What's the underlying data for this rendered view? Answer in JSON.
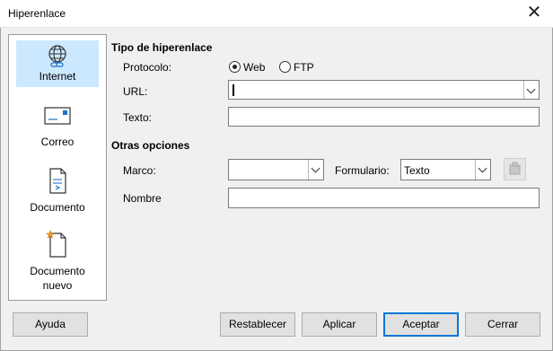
{
  "window": {
    "title": "Hiperenlace",
    "close_glyph": "✕"
  },
  "sidebar": {
    "items": [
      {
        "label": "Internet",
        "icon": "globe-link-icon",
        "selected": true
      },
      {
        "label": "Correo",
        "icon": "envelope-icon",
        "selected": false
      },
      {
        "label": "Documento",
        "icon": "document-icon",
        "selected": false
      },
      {
        "label": "Documento nuevo",
        "icon": "new-document-icon",
        "selected": false
      }
    ]
  },
  "hyperlink_type": {
    "section_title": "Tipo de hiperenlace",
    "protocol_label": "Protocolo:",
    "protocol_options": [
      {
        "label": "Web",
        "checked": true
      },
      {
        "label": "FTP",
        "checked": false
      }
    ],
    "url_label": "URL:",
    "url_value": "",
    "text_label": "Texto:",
    "text_value": ""
  },
  "other_options": {
    "section_title": "Otras opciones",
    "frame_label": "Marco:",
    "frame_value": "",
    "form_label": "Formulario:",
    "form_value": "Texto",
    "name_label": "Nombre",
    "name_value": "",
    "events_icon": "events-icon"
  },
  "buttons": {
    "help": "Ayuda",
    "reset": "Restablecer",
    "apply": "Aplicar",
    "ok": "Aceptar",
    "close": "Cerrar"
  },
  "colors": {
    "selected_bg": "#cce8ff",
    "default_button_border": "#0078d7"
  }
}
